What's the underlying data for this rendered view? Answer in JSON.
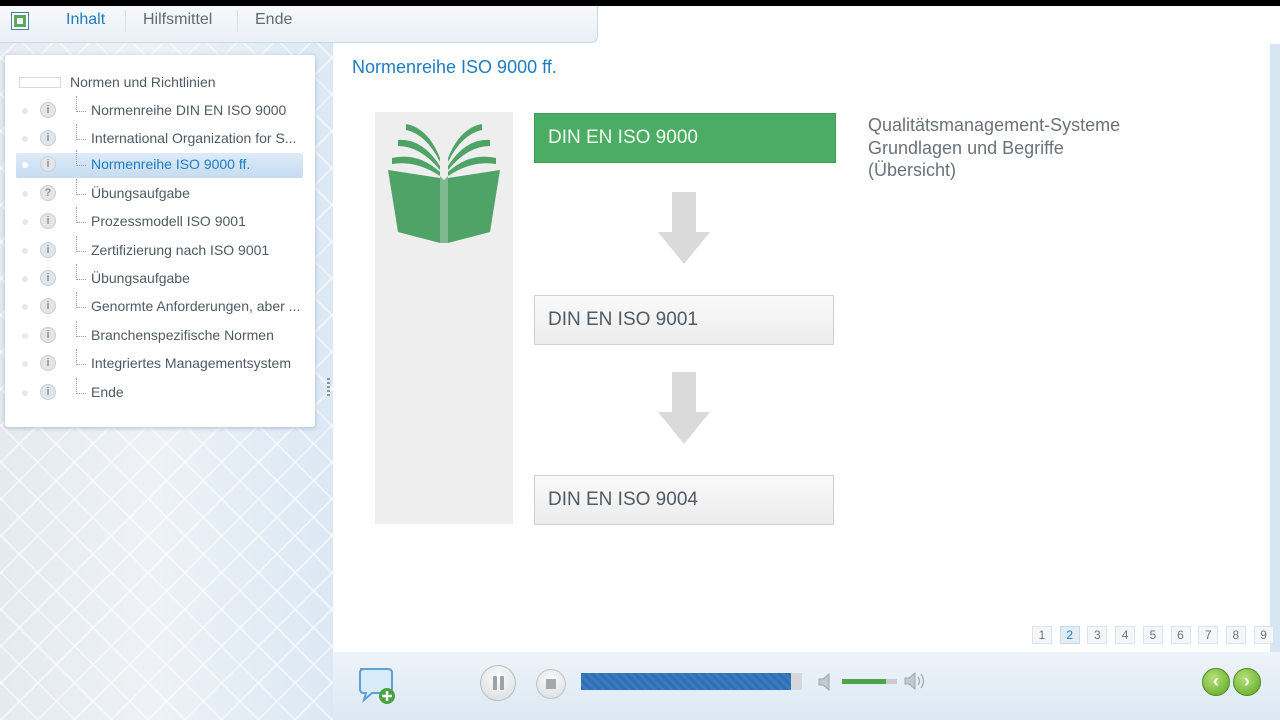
{
  "menu": {
    "items": [
      "Inhalt",
      "Hilfsmittel",
      "Ende"
    ],
    "active": "Inhalt"
  },
  "toc": {
    "root": "Normen und Richtlinien",
    "items": [
      {
        "label": "Normenreihe DIN EN ISO 9000",
        "icon": "info-icon",
        "symbol": "i"
      },
      {
        "label": "International Organization for S...",
        "icon": "info-icon",
        "symbol": "i"
      },
      {
        "label": "Normenreihe ISO 9000 ff.",
        "icon": "info-icon",
        "symbol": "i"
      },
      {
        "label": "Übungsaufgabe",
        "icon": "question-icon",
        "symbol": "?"
      },
      {
        "label": "Prozessmodell ISO 9001",
        "icon": "info-icon",
        "symbol": "i"
      },
      {
        "label": "Zertifizierung nach ISO 9001",
        "icon": "info-icon",
        "symbol": "i"
      },
      {
        "label": "Übungsaufgabe",
        "icon": "info-icon",
        "symbol": "i"
      },
      {
        "label": "Genormte Anforderungen, aber ...",
        "icon": "info-icon",
        "symbol": "i"
      },
      {
        "label": "Branchenspezifische Normen",
        "icon": "info-icon",
        "symbol": "i"
      },
      {
        "label": "Integriertes Managementsystem",
        "icon": "info-icon",
        "symbol": "i"
      },
      {
        "label": "Ende",
        "icon": "info-icon",
        "symbol": "i"
      }
    ],
    "selected_index": 2
  },
  "main": {
    "title": "Normenreihe ISO 9000 ff.",
    "boxes": [
      "DIN EN ISO 9000",
      "DIN EN ISO 9001",
      "DIN EN ISO 9004"
    ],
    "active_box": 0,
    "description": [
      "Qualitätsmanagement-Systeme",
      "Grundlagen  und  Begriffe",
      "(Übersicht)"
    ]
  },
  "pagination": {
    "pages": [
      "1",
      "2",
      "3",
      "4",
      "5",
      "6",
      "7",
      "8",
      "9"
    ],
    "current": "2"
  },
  "player": {
    "progress_fraction": 0.95,
    "volume_fraction": 0.8,
    "prev_symbol": "‹",
    "next_symbol": "›"
  },
  "colors": {
    "accent": "#1e7cc1",
    "active_box": "#4aad63",
    "book_icon": "#4fa366",
    "progress": "#2f6fb3",
    "nav_green": "#5aa51f"
  }
}
